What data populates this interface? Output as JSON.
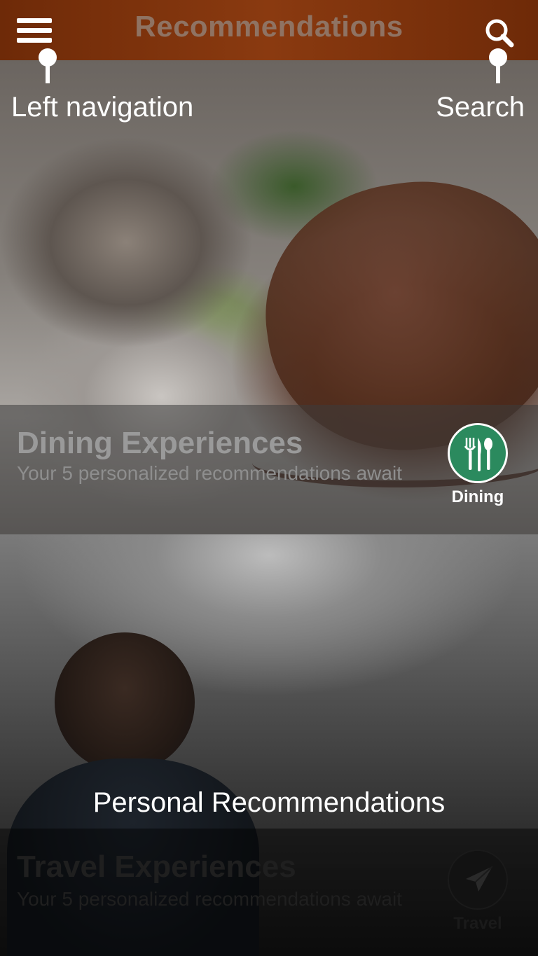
{
  "header": {
    "title": "Recommendations",
    "menu_icon": "menu-icon",
    "search_icon": "search-icon",
    "background_color": "#7a320c"
  },
  "cards": [
    {
      "title": "Dining Experiences",
      "subtitle": "Your 5 personalized recommendations await",
      "category_label": "Dining",
      "category_icon": "fork-knife-spoon-icon",
      "category_color": "#2b8a5e"
    },
    {
      "title": "Travel Experiences",
      "subtitle": "Your 5 personalized recommendations await",
      "category_label": "Travel",
      "category_icon": "paper-plane-icon",
      "category_color": "#121212"
    }
  ],
  "coach_marks": {
    "left_navigation": "Left navigation",
    "search": "Search",
    "personal_recommendations": "Personal Recommendations"
  }
}
